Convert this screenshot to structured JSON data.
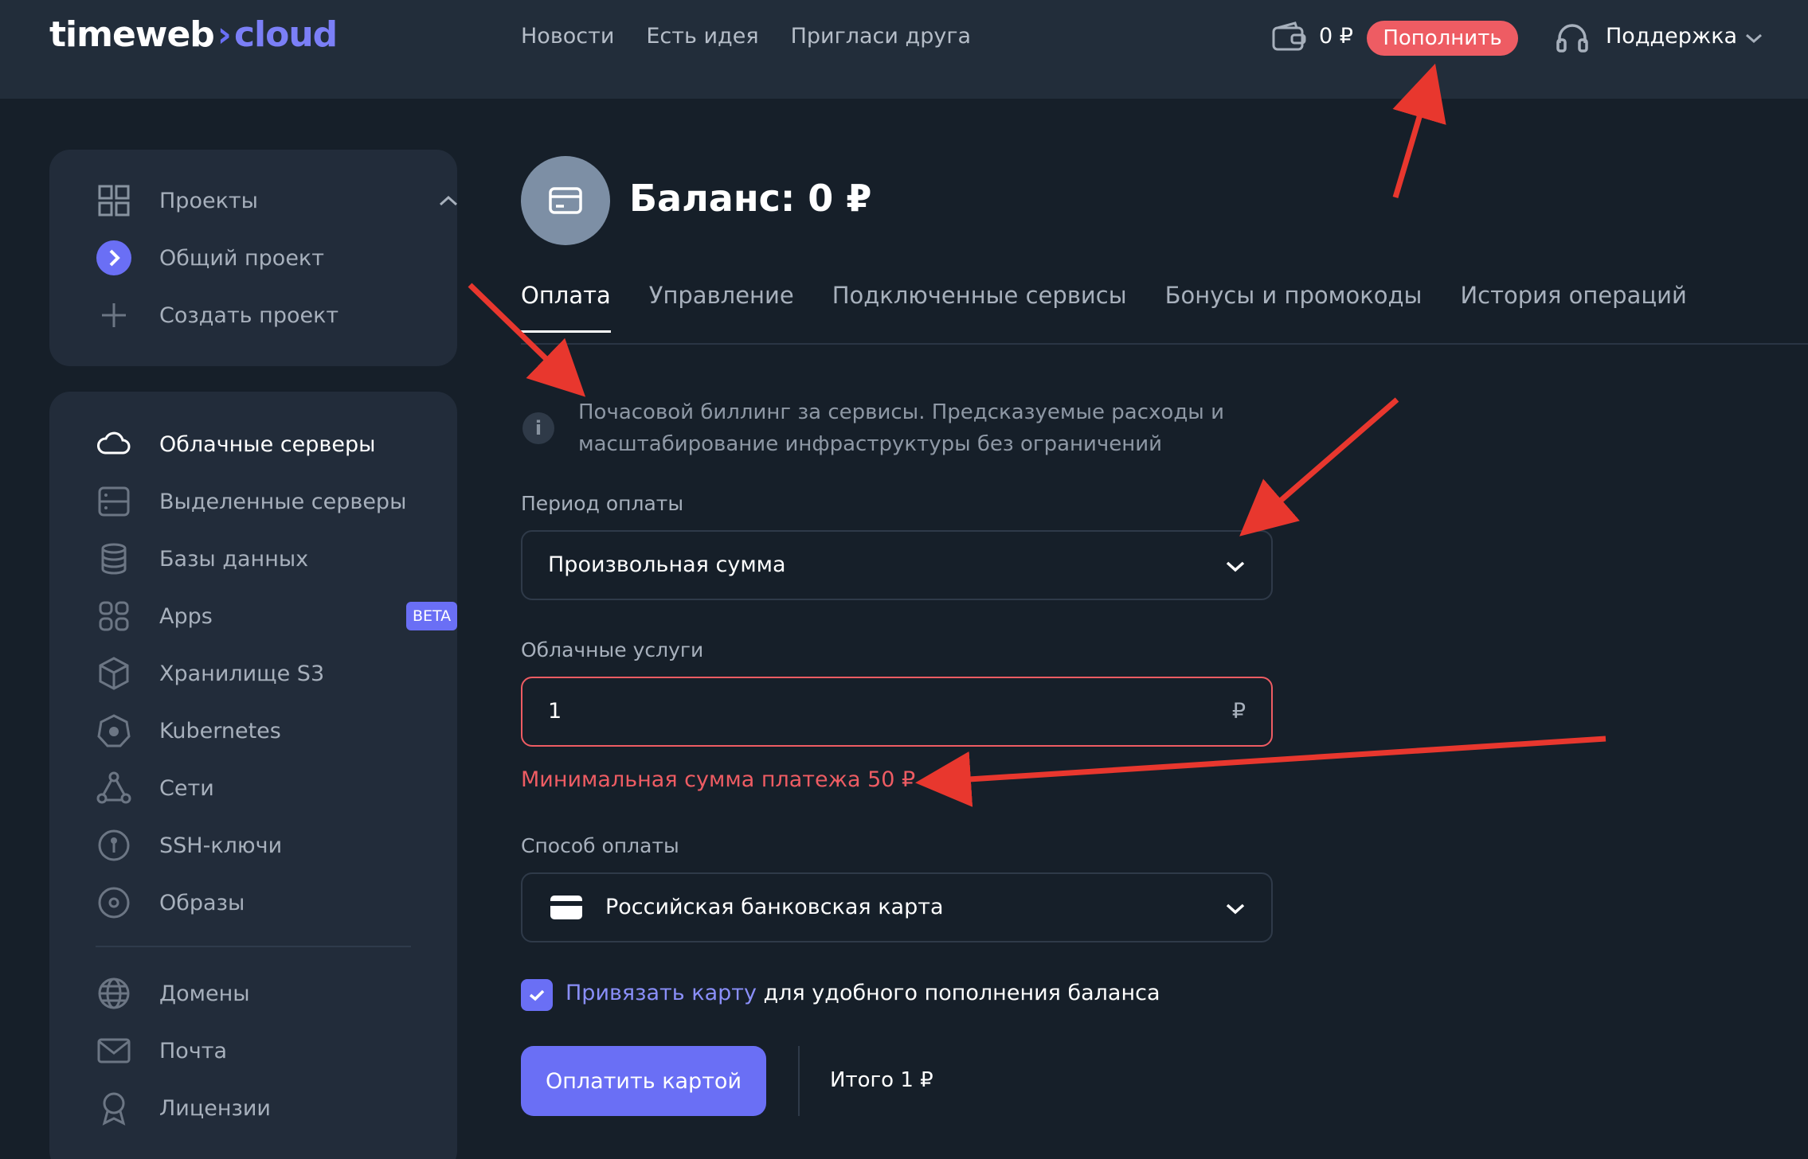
{
  "brand": {
    "part1": "timeweb",
    "arrow": "›",
    "part2": "cloud"
  },
  "topnav": {
    "items": [
      "Новости",
      "Есть идея",
      "Пригласи друга"
    ]
  },
  "header": {
    "balance": "0 ₽",
    "topup_label": "Пополнить",
    "support_label": "Поддержка"
  },
  "sidebar": {
    "projects": [
      {
        "label": "Проекты",
        "icon": "grid-icon"
      },
      {
        "label": "Общий проект",
        "icon": "chevron-right-circle-icon"
      },
      {
        "label": "Создать проект",
        "icon": "plus-icon"
      }
    ],
    "services": [
      {
        "label": "Облачные серверы",
        "icon": "cloud-icon"
      },
      {
        "label": "Выделенные серверы",
        "icon": "server-icon"
      },
      {
        "label": "Базы данных",
        "icon": "database-icon"
      },
      {
        "label": "Apps",
        "icon": "apps-icon",
        "badge": "BETA"
      },
      {
        "label": "Хранилище S3",
        "icon": "cube-icon"
      },
      {
        "label": "Kubernetes",
        "icon": "kubernetes-icon"
      },
      {
        "label": "Сети",
        "icon": "network-icon"
      },
      {
        "label": "SSH-ключи",
        "icon": "key-icon"
      },
      {
        "label": "Образы",
        "icon": "disc-icon"
      },
      {
        "label": "Домены",
        "icon": "globe-icon"
      },
      {
        "label": "Почта",
        "icon": "mail-icon"
      },
      {
        "label": "Лицензии",
        "icon": "license-icon"
      }
    ]
  },
  "main": {
    "title": "Баланс: 0 ₽",
    "tabs": [
      "Оплата",
      "Управление",
      "Подключенные сервисы",
      "Бонусы и промокоды",
      "История операций"
    ],
    "info_text": "Почасовой биллинг за сервисы. Предсказуемые расходы и масштабирование инфраструктуры без ограничений",
    "period_label": "Период оплаты",
    "period_value": "Произвольная сумма",
    "amount_label": "Облачные услуги",
    "amount_value": "1",
    "currency": "₽",
    "error_text": "Минимальная сумма платежа 50 ₽",
    "method_label": "Способ оплаты",
    "method_value": "Российская банковская карта",
    "bind_link": "Привязать карту",
    "bind_rest": " для удобного пополнения баланса",
    "pay_button": "Оплатить картой",
    "total": "Итого 1 ₽"
  },
  "colors": {
    "accent": "#6a6ff5",
    "danger": "#ee5c63",
    "annotation": "#e8372e"
  }
}
